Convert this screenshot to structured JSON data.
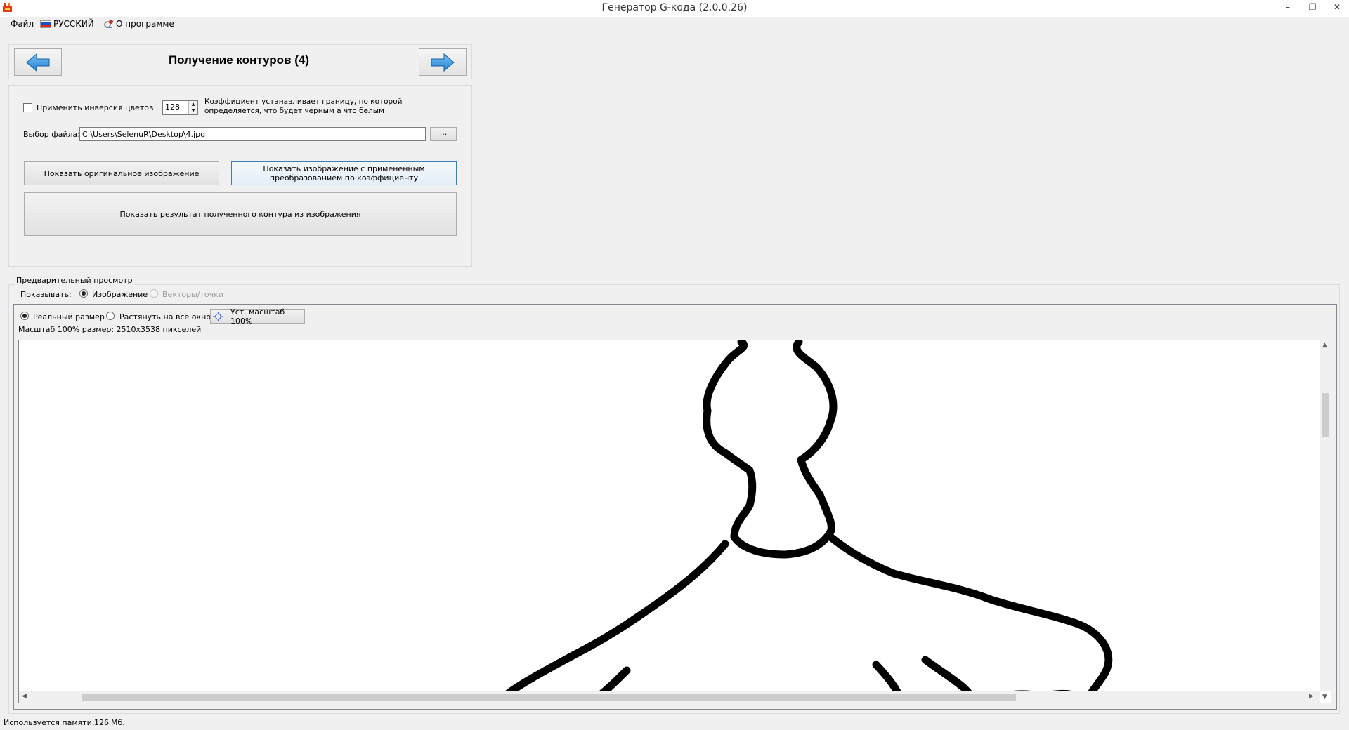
{
  "window": {
    "title": "Генератор G-кода (2.0.0.26)",
    "icon": "app-icon",
    "controls": [
      "minimize-icon",
      "restore-icon",
      "close-icon"
    ],
    "minimize_glyph": "–",
    "restore_glyph": "❐",
    "close_glyph": "✕"
  },
  "menu": {
    "file": "Файл",
    "language": "РУССКИЙ",
    "about": "О программе"
  },
  "wizard": {
    "title": "Получение контуров (4)",
    "back_icon": "arrow-left-icon",
    "next_icon": "arrow-right-icon"
  },
  "settings": {
    "invert_label": "Применить инверсия цветов",
    "invert_checked": false,
    "threshold_value": "128",
    "threshold_hint": "Коэффициент устанавливает границу, по которой определяется, что будет  черным а что белым",
    "file_label": "Выбор файла:",
    "file_path": "C:\\Users\\SelenuR\\Desktop\\4.jpg",
    "browse_label": "...",
    "btn_original": "Показать оригинальное изображение",
    "btn_threshold": "Показать изображение с примененным преобразованием по коэффициенту",
    "btn_contour": "Показать результат полученного контура из изображения"
  },
  "preview": {
    "group_label": "Предварительный просмотр",
    "show_label": "Показывать:",
    "mode_image": "Изображение",
    "mode_vectors": "Векторы/точки",
    "mode_selected": "image",
    "size_real": "Реальный размер",
    "size_stretch": "Растянуть на всё окно",
    "size_selected": "real",
    "scale_button": "Уст. масштаб 100%",
    "scale_info": "Масштаб 100% размер: 2510x3538 пикселей"
  },
  "status": {
    "memory_label": "Используется памяти:",
    "memory_value": "126",
    "memory_unit": "Мб."
  },
  "colors": {
    "accent_blue": "#2f8fd8",
    "focus_border": "#3c7fb1",
    "background": "#f0f0f0"
  }
}
